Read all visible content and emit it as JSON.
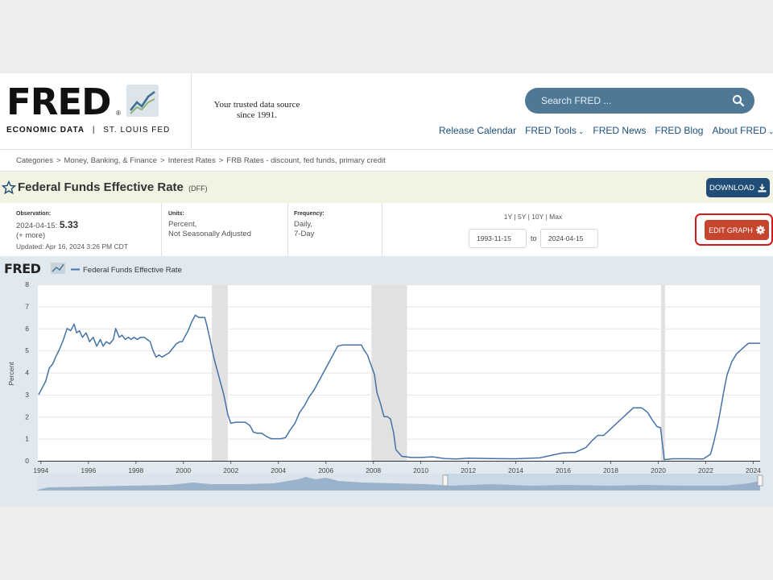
{
  "header": {
    "logo_text": "FRED",
    "logo_reg": "®",
    "logo_sub_left": "ECONOMIC DATA",
    "logo_sub_sep": "|",
    "logo_sub_right": "ST. LOUIS FED",
    "tagline_line1": "Your trusted data source",
    "tagline_line2": "since 1991.",
    "search_placeholder": "Search FRED ...",
    "nav": [
      {
        "label": "Release Calendar",
        "chevron": false
      },
      {
        "label": "FRED Tools",
        "chevron": true
      },
      {
        "label": "FRED News",
        "chevron": false
      },
      {
        "label": "FRED Blog",
        "chevron": false
      },
      {
        "label": "About FRED",
        "chevron": true
      }
    ]
  },
  "breadcrumb": [
    "Categories",
    "Money, Banking, & Finance",
    "Interest Rates",
    "FRB Rates - discount, fed funds, primary credit"
  ],
  "breadcrumb_sep": ">",
  "series": {
    "title": "Federal Funds Effective Rate",
    "id": "(DFF)",
    "download_label": "DOWNLOAD"
  },
  "meta": {
    "observation_label": "Observation:",
    "observation_date": "2024-04-15:",
    "observation_value": "5.33",
    "more": "(+ more)",
    "updated": "Updated: Apr 16, 2024 3:26 PM CDT",
    "units_label": "Units:",
    "units_line1": "Percent,",
    "units_line2": "Not Seasonally Adjusted",
    "frequency_label": "Frequency:",
    "frequency_line1": "Daily,",
    "frequency_line2": "7-Day",
    "range_links": [
      "1Y",
      "5Y",
      "10Y",
      "Max"
    ],
    "range_sep": "|",
    "start_date": "1993-11-15",
    "to_label": "to",
    "end_date": "2024-04-15",
    "edit_graph_label": "EDIT GRAPH"
  },
  "colors": {
    "line": "#4572a7",
    "recession": "#e1e1e1",
    "edit_button": "#c5452e",
    "highlight": "#d11a1a",
    "download_button": "#1f4d75"
  },
  "chart_data": {
    "type": "line",
    "logo": "FRED",
    "ylabel": "Percent",
    "xlabel": "",
    "xlim": [
      1993.87,
      2024.29
    ],
    "ylim": [
      0,
      8
    ],
    "yticks": [
      0,
      1,
      2,
      3,
      4,
      5,
      6,
      7,
      8
    ],
    "xticks": [
      1994,
      1996,
      1998,
      2000,
      2002,
      2004,
      2006,
      2008,
      2010,
      2012,
      2014,
      2016,
      2018,
      2020,
      2022,
      2024
    ],
    "grid": true,
    "legend_position": "top-left",
    "recessions": [
      [
        2001.2,
        2001.87
      ],
      [
        2007.92,
        2009.42
      ],
      [
        2020.12,
        2020.29
      ]
    ],
    "series": [
      {
        "name": "Federal Funds Effective Rate",
        "x": [
          1993.9,
          1994.05,
          1994.2,
          1994.35,
          1994.5,
          1994.62,
          1994.8,
          1994.95,
          1995.1,
          1995.25,
          1995.4,
          1995.5,
          1995.62,
          1995.75,
          1995.9,
          1996.05,
          1996.2,
          1996.35,
          1996.5,
          1996.62,
          1996.75,
          1996.9,
          1997.05,
          1997.15,
          1997.3,
          1997.42,
          1997.55,
          1997.68,
          1997.8,
          1997.92,
          1998.05,
          1998.2,
          1998.35,
          1998.48,
          1998.6,
          1998.72,
          1998.85,
          1998.97,
          1999.1,
          1999.25,
          1999.4,
          1999.55,
          1999.7,
          1999.85,
          1999.95,
          2000.05,
          2000.2,
          2000.35,
          2000.5,
          2000.65,
          2000.8,
          2000.9,
          2001.0,
          2001.12,
          2001.3,
          2001.5,
          2001.7,
          2001.87,
          2002.0,
          2002.2,
          2002.4,
          2002.6,
          2002.8,
          2002.95,
          2003.1,
          2003.3,
          2003.5,
          2003.7,
          2003.9,
          2004.1,
          2004.3,
          2004.5,
          2004.7,
          2004.9,
          2005.1,
          2005.3,
          2005.5,
          2005.7,
          2005.9,
          2006.1,
          2006.3,
          2006.5,
          2006.7,
          2006.9,
          2007.1,
          2007.3,
          2007.5,
          2007.62,
          2007.75,
          2007.85,
          2007.95,
          2008.05,
          2008.15,
          2008.3,
          2008.45,
          2008.6,
          2008.72,
          2008.85,
          2008.95,
          2009.2,
          2009.6,
          2010.0,
          2010.5,
          2011.0,
          2011.5,
          2012.0,
          2013.0,
          2014.0,
          2015.0,
          2015.95,
          2016.5,
          2016.95,
          2017.2,
          2017.45,
          2017.7,
          2017.95,
          2018.2,
          2018.45,
          2018.7,
          2018.95,
          2019.3,
          2019.55,
          2019.75,
          2019.95,
          2020.1,
          2020.25,
          2020.6,
          2021.2,
          2021.9,
          2022.2,
          2022.35,
          2022.5,
          2022.62,
          2022.75,
          2022.9,
          2023.1,
          2023.3,
          2023.55,
          2023.8,
          2024.0,
          2024.29
        ],
        "values": [
          3.0,
          3.3,
          3.6,
          4.2,
          4.4,
          4.7,
          5.1,
          5.5,
          6.0,
          5.9,
          6.2,
          5.8,
          5.9,
          5.6,
          5.8,
          5.4,
          5.6,
          5.2,
          5.5,
          5.2,
          5.4,
          5.3,
          5.5,
          6.0,
          5.6,
          5.7,
          5.5,
          5.6,
          5.5,
          5.6,
          5.5,
          5.6,
          5.6,
          5.5,
          5.4,
          5.0,
          4.7,
          4.8,
          4.7,
          4.8,
          4.9,
          5.1,
          5.3,
          5.4,
          5.4,
          5.6,
          5.9,
          6.3,
          6.6,
          6.5,
          6.5,
          6.5,
          6.1,
          5.5,
          4.6,
          3.8,
          3.0,
          2.1,
          1.7,
          1.75,
          1.75,
          1.75,
          1.6,
          1.3,
          1.25,
          1.25,
          1.1,
          1.0,
          1.0,
          1.0,
          1.05,
          1.4,
          1.7,
          2.2,
          2.5,
          2.9,
          3.2,
          3.6,
          4.0,
          4.4,
          4.8,
          5.2,
          5.25,
          5.25,
          5.25,
          5.25,
          5.25,
          5.0,
          4.8,
          4.5,
          4.2,
          3.9,
          3.1,
          2.6,
          2.0,
          2.0,
          1.9,
          1.3,
          0.5,
          0.2,
          0.15,
          0.15,
          0.18,
          0.1,
          0.08,
          0.12,
          0.1,
          0.09,
          0.13,
          0.35,
          0.38,
          0.6,
          0.9,
          1.15,
          1.15,
          1.4,
          1.65,
          1.9,
          2.15,
          2.4,
          2.4,
          2.2,
          1.85,
          1.55,
          1.5,
          0.05,
          0.09,
          0.09,
          0.08,
          0.3,
          0.9,
          1.6,
          2.3,
          3.1,
          3.9,
          4.5,
          4.85,
          5.1,
          5.33,
          5.33,
          5.33
        ]
      }
    ]
  }
}
